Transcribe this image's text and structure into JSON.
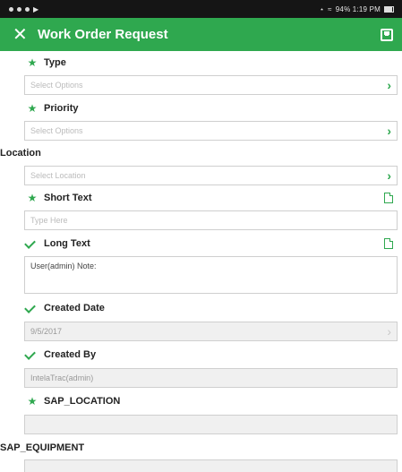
{
  "status_bar": {
    "left": "",
    "right": "94% 1:19 PM"
  },
  "app_bar": {
    "title": "Work Order Request",
    "close_icon": "close-icon",
    "save_icon": "save-icon",
    "color": "#2fa84f"
  },
  "fields": {
    "type": {
      "label": "Type",
      "placeholder": "Select Options",
      "required": true
    },
    "priority": {
      "label": "Priority",
      "placeholder": "Select Options",
      "required": true
    },
    "location": {
      "label": "Location",
      "placeholder": "Select Location",
      "required": false
    },
    "short_text": {
      "label": "Short Text",
      "placeholder": "Type Here",
      "required": true
    },
    "long_text": {
      "label": "Long Text",
      "value": "User(admin) Note:",
      "completed": true
    },
    "created_date": {
      "label": "Created Date",
      "value": "9/5/2017",
      "completed": true
    },
    "created_by": {
      "label": "Created By",
      "value": "IntelaTrac(admin)",
      "completed": true
    },
    "sap_location": {
      "label": "SAP_LOCATION",
      "value": "",
      "required": true
    },
    "sap_equipment": {
      "label": "SAP_EQUIPMENT",
      "value": ""
    }
  }
}
